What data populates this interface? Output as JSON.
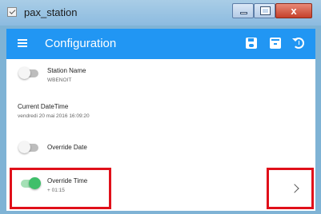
{
  "window": {
    "title": "pax_station",
    "controls": {
      "minimize_icon": "minimize-icon",
      "maximize_icon": "maximize-icon",
      "close_label": "x"
    }
  },
  "appbar": {
    "menu_icon": "hamburger-menu-icon",
    "title": "Configuration",
    "actions": [
      {
        "icon": "save-icon"
      },
      {
        "icon": "archive-icon"
      },
      {
        "icon": "restore-history-icon"
      }
    ],
    "color": "#2196f3"
  },
  "settings": {
    "station_name": {
      "label": "Station Name",
      "value": "WBENOIT",
      "toggle_on": false
    },
    "current_datetime": {
      "label": "Current DateTime",
      "value": "vendredi 20 mai 2016 16:09:20"
    },
    "override_date": {
      "label": "Override Date",
      "toggle_on": false
    },
    "override_time": {
      "label": "Override Time",
      "value": "+ 01:15",
      "toggle_on": true
    }
  },
  "highlight_color": "#e0101a",
  "toggle_on_color": "#3fbf6a"
}
